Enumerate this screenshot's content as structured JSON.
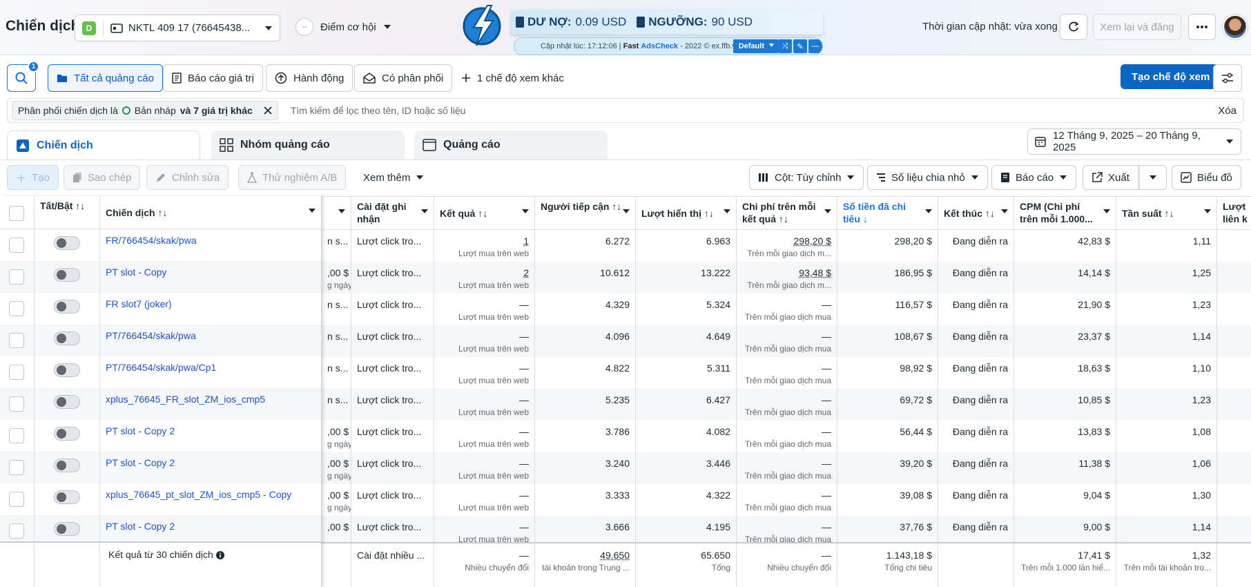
{
  "header": {
    "title": "Chiến dịch",
    "account_badge": "D",
    "account_name": "NKTL 409 17 (76645438...",
    "opportunity_label": "Điểm cơ hội",
    "opportunity_score": "--",
    "update_time": "Thời gian cập nhật: vừa xong",
    "review_button": "Xem lại và đăng"
  },
  "adscheck": {
    "debt_label": "DƯ NỢ:",
    "debt_value": "0.09 USD",
    "threshold_label": "NGƯỠNG:",
    "threshold_value": "90 USD",
    "updated_text": "Cập nhật lúc: 17:12:06 |",
    "fast": "Fast",
    "ads": "AdsCheck",
    "copyright": "- 2022 © ex.ffb.vn",
    "preset": "Default"
  },
  "toolbar": {
    "search_badge": "1",
    "all_ads": "Tất cả quảng cáo",
    "value_report": "Báo cáo giá trị",
    "actions": "Hành động",
    "delivery": "Có phân phối",
    "more_views": "1 chế độ xem khác",
    "create_view": "Tạo chế độ xem"
  },
  "filter": {
    "chip_prefix": "Phân phối chiến dịch là",
    "chip_value": "Bản nháp",
    "chip_suffix": "và 7 giá trị khác",
    "search_placeholder": "Tìm kiếm để lọc theo tên, ID hoặc số liệu",
    "clear": "Xóa"
  },
  "tabs": {
    "campaigns": "Chiến dịch",
    "adsets": "Nhóm quảng cáo",
    "ads": "Quảng cáo"
  },
  "date_range": "12 Tháng 9, 2025 – 20 Tháng 9, 2025",
  "actions": {
    "create": "Tạo",
    "duplicate": "Sao chép",
    "edit": "Chỉnh sửa",
    "ab_test": "Thử nghiệm A/B",
    "see_more": "Xem thêm",
    "columns": "Cột: Tùy chỉnh",
    "breakdown": "Số liệu chia nhỏ",
    "reports": "Báo cáo",
    "export": "Xuất",
    "charts": "Biểu đồ"
  },
  "columns": {
    "toggle": "Tất/Bật ↑↓",
    "campaign": "Chiến dịch ↑↓",
    "attribution": "Cài đặt ghi nhận",
    "results": "Kết quả ↑↓",
    "reach": "Người tiếp cận ↑↓",
    "impressions": "Lượt hiển thị ↑↓",
    "cpr": "Chi phí trên mỗi kết quả ↑↓",
    "spent": "Số tiền đã chi tiêu ↓",
    "ends": "Kết thúc ↑↓",
    "cpm": "CPM (Chi phí trên mỗi 1.000...",
    "frequency": "Tần suất ↑↓",
    "link_clicks": "Lượt liên k"
  },
  "rows": [
    {
      "name": "FR/766454/skak/pwa",
      "budget": "n s...",
      "budget_sub": "",
      "attribution": "Lượt click tro...",
      "result": "1",
      "result_sub": "Lượt mua trên web",
      "reach": "6.272",
      "impressions": "6.963",
      "cpr": "298,20 $",
      "cpr_sub": "Trên mỗi giao dịch m...",
      "spent": "298,20 $",
      "ends": "Đang diễn ra",
      "cpm": "42,83 $",
      "freq": "1,11"
    },
    {
      "name": "PT slot - Copy",
      "budget": ",00 $",
      "budget_sub": "g ngày",
      "attribution": "Lượt click tro...",
      "result": "2",
      "result_sub": "Lượt mua trên web",
      "reach": "10.612",
      "impressions": "13.222",
      "cpr": "93,48 $",
      "cpr_sub": "Trên mỗi giao dịch m...",
      "spent": "186,95 $",
      "ends": "Đang diễn ra",
      "cpm": "14,14 $",
      "freq": "1,25"
    },
    {
      "name": "FR slot7 (joker)",
      "budget": "n s...",
      "budget_sub": "",
      "attribution": "Lượt click tro...",
      "result": "—",
      "result_sub": "Lượt mua trên web",
      "reach": "4.329",
      "impressions": "5.324",
      "cpr": "—",
      "cpr_sub": "Trên mỗi giao dịch mua",
      "spent": "116,57 $",
      "ends": "Đang diễn ra",
      "cpm": "21,90 $",
      "freq": "1,23"
    },
    {
      "name": "PT/766454/skak/pwa",
      "budget": "n s...",
      "budget_sub": "",
      "attribution": "Lượt click tro...",
      "result": "—",
      "result_sub": "Lượt mua trên web",
      "reach": "4.096",
      "impressions": "4.649",
      "cpr": "—",
      "cpr_sub": "Trên mỗi giao dịch mua",
      "spent": "108,67 $",
      "ends": "Đang diễn ra",
      "cpm": "23,37 $",
      "freq": "1,14"
    },
    {
      "name": "PT/766454/skak/pwa/Cp1",
      "budget": "n s...",
      "budget_sub": "",
      "attribution": "Lượt click tro...",
      "result": "—",
      "result_sub": "Lượt mua trên web",
      "reach": "4.822",
      "impressions": "5.311",
      "cpr": "—",
      "cpr_sub": "Trên mỗi giao dịch mua",
      "spent": "98,92 $",
      "ends": "Đang diễn ra",
      "cpm": "18,63 $",
      "freq": "1,10"
    },
    {
      "name": "xplus_76645_FR_slot_ZM_ios_cmp5",
      "budget": "n s...",
      "budget_sub": "",
      "attribution": "Lượt click tro...",
      "result": "—",
      "result_sub": "Lượt mua trên web",
      "reach": "5.235",
      "impressions": "6.427",
      "cpr": "—",
      "cpr_sub": "Trên mỗi giao dịch mua",
      "spent": "69,72 $",
      "ends": "Đang diễn ra",
      "cpm": "10,85 $",
      "freq": "1,23"
    },
    {
      "name": "PT slot - Copy 2",
      "budget": ",00 $",
      "budget_sub": "g ngày",
      "attribution": "Lượt click tro...",
      "result": "—",
      "result_sub": "Lượt mua trên web",
      "reach": "3.786",
      "impressions": "4.082",
      "cpr": "—",
      "cpr_sub": "Trên mỗi giao dịch mua",
      "spent": "56,44 $",
      "ends": "Đang diễn ra",
      "cpm": "13,83 $",
      "freq": "1,08"
    },
    {
      "name": "PT slot - Copy 2",
      "budget": ",00 $",
      "budget_sub": "g ngày",
      "attribution": "Lượt click tro...",
      "result": "—",
      "result_sub": "Lượt mua trên web",
      "reach": "3.240",
      "impressions": "3.446",
      "cpr": "—",
      "cpr_sub": "Trên mỗi giao dịch mua",
      "spent": "39,20 $",
      "ends": "Đang diễn ra",
      "cpm": "11,38 $",
      "freq": "1,06"
    },
    {
      "name": "xplus_76645_pt_slot_ZM_ios_cmp5 - Copy",
      "budget": ",00 $",
      "budget_sub": "g ngày",
      "attribution": "Lượt click tro...",
      "result": "—",
      "result_sub": "Lượt mua trên web",
      "reach": "3.333",
      "impressions": "4.322",
      "cpr": "—",
      "cpr_sub": "Trên mỗi giao dịch mua",
      "spent": "39,08 $",
      "ends": "Đang diễn ra",
      "cpm": "9,04 $",
      "freq": "1,30"
    },
    {
      "name": "PT slot - Copy 2",
      "budget": ",00 $",
      "budget_sub": "",
      "attribution": "Lượt click tro...",
      "result": "—",
      "result_sub": "Lượt mua trên web",
      "reach": "3.666",
      "impressions": "4.195",
      "cpr": "—",
      "cpr_sub": "Trên mỗi giao dịch mua",
      "spent": "37,76 $",
      "ends": "Đang diễn ra",
      "cpm": "9,00 $",
      "freq": "1,14"
    }
  ],
  "footer": {
    "label": "Kết quả từ 30 chiến dịch",
    "attribution": "Cài đặt nhiều ...",
    "result": "—",
    "result_sub": "Nhiều chuyển đổi",
    "reach": "49.650",
    "reach_sub": "tài khoản trong Trung ...",
    "impressions": "65.650",
    "impressions_sub": "Tổng",
    "cpr": "—",
    "cpr_sub": "Nhiều chuyển đổi",
    "spent": "1.143,18 $",
    "spent_sub": "Tổng chi tiêu",
    "cpm": "17,41 $",
    "cpm_sub": "Trên mỗi 1.000 lần hiể...",
    "freq": "1,32",
    "freq_sub": "Trên mỗi tài khoản tro..."
  }
}
